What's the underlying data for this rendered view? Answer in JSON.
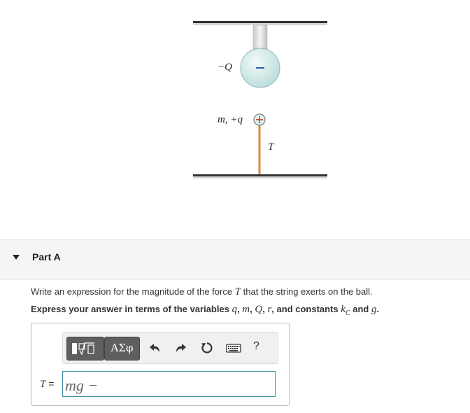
{
  "figure": {
    "upper_ball_label": "−Q",
    "upper_ball_sign": "−",
    "lower_ball_label": "m, +q",
    "lower_ball_sign": "+",
    "tension_label": "T",
    "colors": {
      "ball": "#cfe8e6",
      "string": "#d98a3a",
      "plate": "#333333"
    }
  },
  "part": {
    "title": "Part A",
    "expanded": true
  },
  "question": {
    "prompt_before": "Write an expression for the magnitude of the force ",
    "prompt_var": "T",
    "prompt_after": " that the string exerts on the ball.",
    "instruction_prefix": "Express your answer in terms of the variables ",
    "var_q": "q",
    "sep1": ", ",
    "var_m": "m",
    "sep2": ", ",
    "var_Q": "Q",
    "sep3": ", ",
    "var_r": "r",
    "instruction_mid": ", and constants ",
    "const_k": "k",
    "const_k_sub": "C",
    "instruction_and": " and ",
    "const_g": "g",
    "instruction_end": "."
  },
  "toolbar": {
    "greek_label": "ΑΣφ",
    "help_label": "?",
    "icons": [
      "templates-icon",
      "greek-icon",
      "undo-icon",
      "redo-icon",
      "reset-icon",
      "keyboard-icon",
      "help-icon"
    ]
  },
  "answer": {
    "var": "T",
    "equals": " =",
    "value": "mg −"
  }
}
